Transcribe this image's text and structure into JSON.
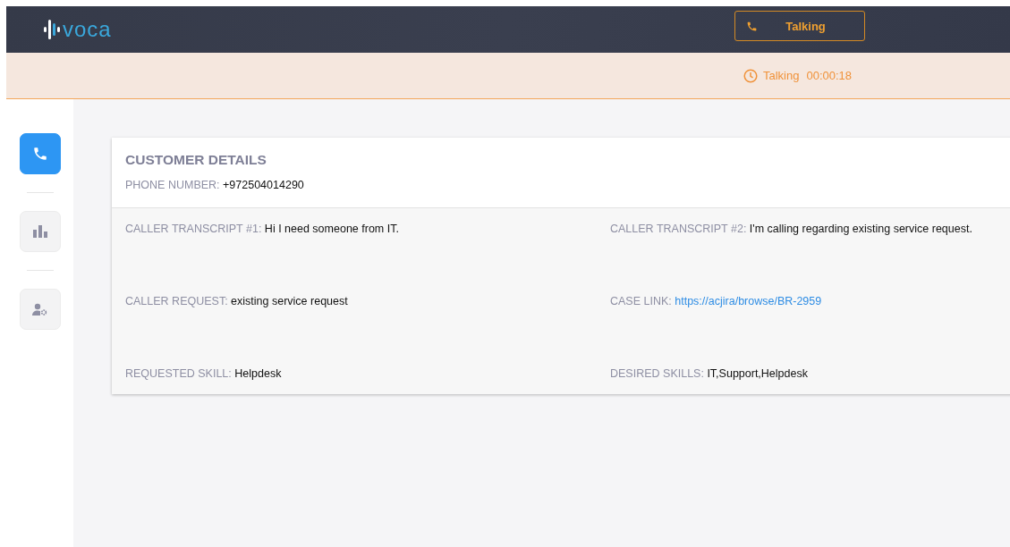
{
  "header": {
    "logo": "voca",
    "status_button": {
      "label": "Talking"
    }
  },
  "status_bar": {
    "state": "Talking",
    "timer": "00:00:18"
  },
  "sidebar": {
    "items": [
      {
        "kind": "phone",
        "selected": true
      },
      {
        "kind": "chart",
        "selected": false
      },
      {
        "kind": "user",
        "selected": false
      }
    ]
  },
  "customer_details": {
    "title": "CUSTOMER DETAILS",
    "phone": {
      "label": "PHONE NUMBER:",
      "value": "+972504014290"
    },
    "fields": [
      {
        "label": "CALLER TRANSCRIPT #1:",
        "value": "Hi I need someone from IT.",
        "kind": "text"
      },
      {
        "label": "CALLER TRANSCRIPT #2:",
        "value": "I'm calling regarding existing service request.",
        "kind": "text"
      },
      {
        "label": "CALLER REQUEST:",
        "value": "existing service request",
        "kind": "text"
      },
      {
        "label": "CASE LINK:",
        "value": "https://acjira/browse/BR-2959",
        "kind": "link"
      },
      {
        "label": "REQUESTED SKILL:",
        "value": "Helpdesk",
        "kind": "text"
      },
      {
        "label": "DESIRED SKILLS:",
        "value": "IT,Support,Helpdesk",
        "kind": "text"
      }
    ]
  }
}
